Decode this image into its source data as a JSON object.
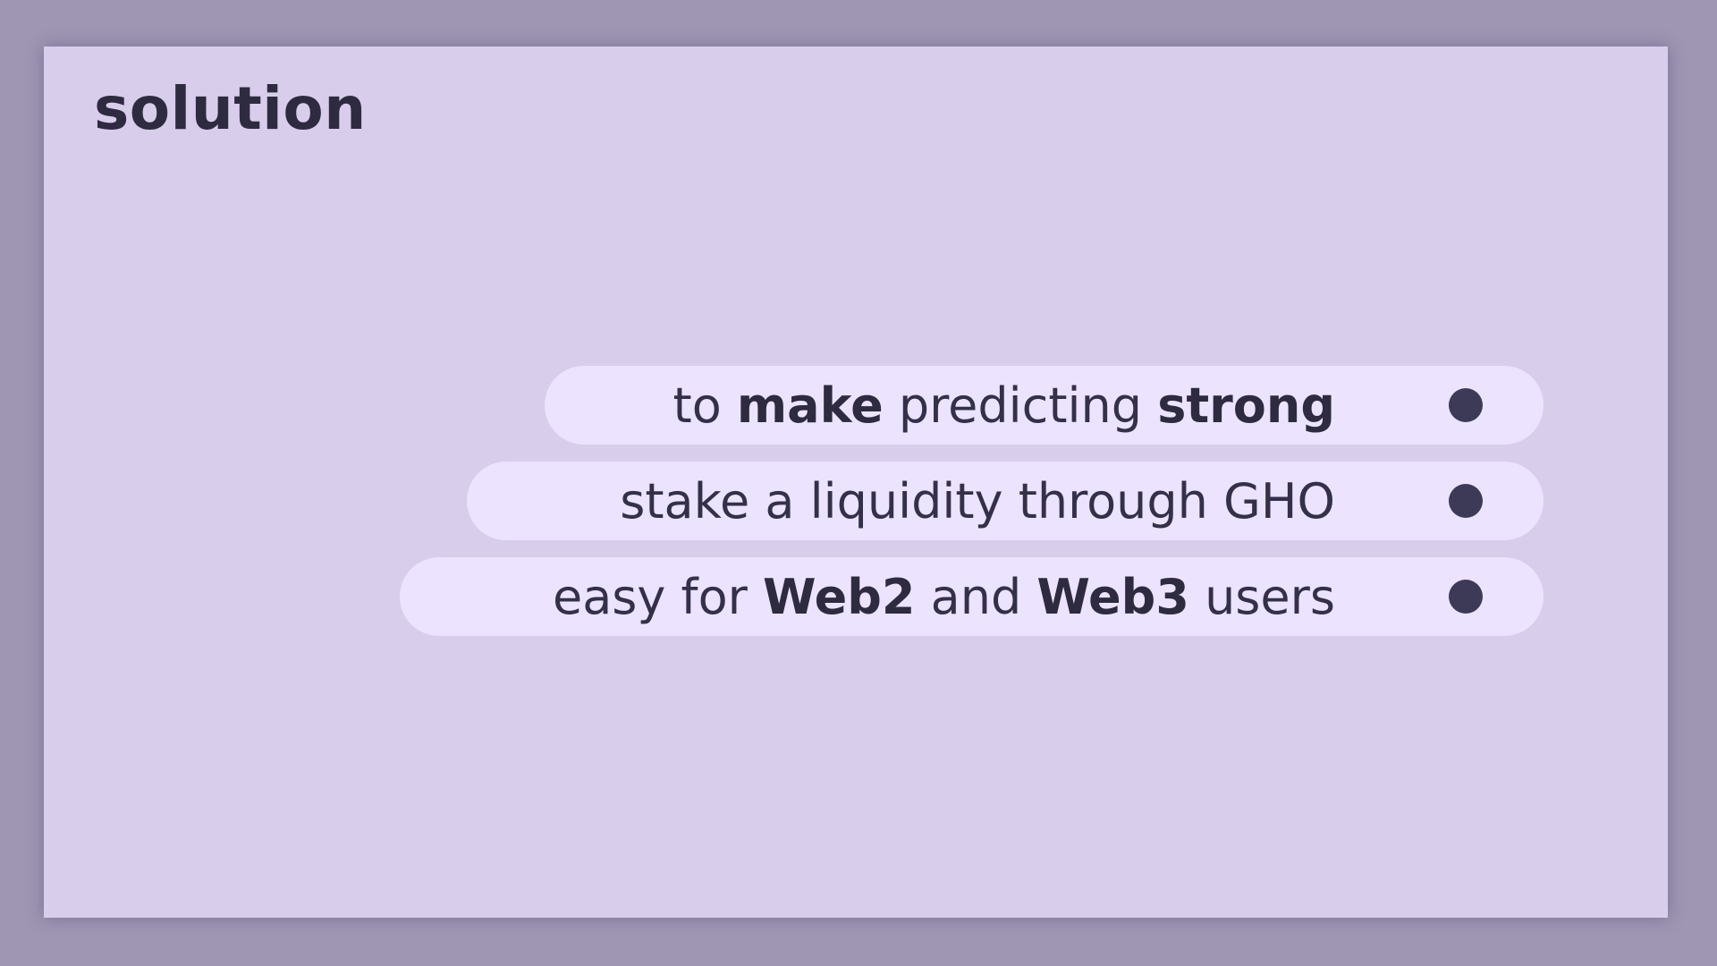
{
  "slide": {
    "title": "solution",
    "items": [
      {
        "segments": [
          {
            "text": "to ",
            "bold": false
          },
          {
            "text": "make",
            "bold": true
          },
          {
            "text": " predicting ",
            "bold": false
          },
          {
            "text": "strong",
            "bold": true
          }
        ]
      },
      {
        "segments": [
          {
            "text": "stake a liquidity through GHO",
            "bold": false
          }
        ]
      },
      {
        "segments": [
          {
            "text": "easy for ",
            "bold": false
          },
          {
            "text": "Web2",
            "bold": true
          },
          {
            "text": " and ",
            "bold": false
          },
          {
            "text": "Web3",
            "bold": true
          },
          {
            "text": " users",
            "bold": false
          }
        ]
      }
    ]
  },
  "colors": {
    "background": "#9e96b3",
    "slide": "#d8cdeb",
    "pill": "#ece4fe",
    "text": "#2e2b40",
    "bullet": "#3d3a58"
  }
}
